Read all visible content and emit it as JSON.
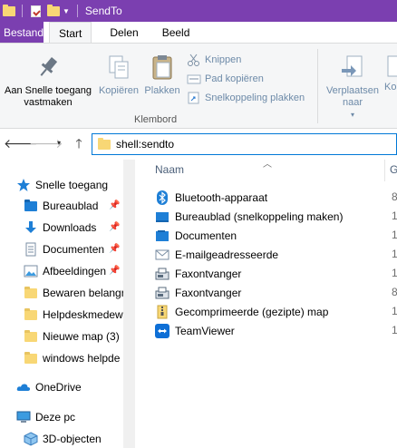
{
  "window": {
    "title": "SendTo"
  },
  "ribbon_tabs": {
    "file": "Bestand",
    "start": "Start",
    "share": "Delen",
    "view": "Beeld"
  },
  "ribbon": {
    "pin_quick_access": "Aan Snelle toegang vastmaken",
    "copy": "Kopiëren",
    "paste": "Plakken",
    "cut": "Knippen",
    "copy_path": "Pad kopiëren",
    "paste_shortcut": "Snelkoppeling plakken",
    "move_to": "Verplaatsen naar",
    "copy_to_partial": "Ko",
    "group_clipboard": "Klembord"
  },
  "address": {
    "path": "shell:sendto"
  },
  "nav_pane": {
    "quick_access": "Snelle toegang",
    "items": [
      {
        "label": "Bureaublad",
        "pinned": true
      },
      {
        "label": "Downloads",
        "pinned": true
      },
      {
        "label": "Documenten",
        "pinned": true
      },
      {
        "label": "Afbeeldingen",
        "pinned": true
      },
      {
        "label": "Bewaren belangr",
        "pinned": false
      },
      {
        "label": "Helpdeskmedew",
        "pinned": false
      },
      {
        "label": "Nieuwe map (3)",
        "pinned": false
      },
      {
        "label": "windows helpde",
        "pinned": false
      }
    ],
    "onedrive": "OneDrive",
    "this_pc": "Deze pc",
    "objects_3d": "3D-objecten"
  },
  "content": {
    "column_name": "Naam",
    "column_next": "G",
    "files": [
      {
        "name": "Bluetooth-apparaat",
        "icon": "bluetooth-icon",
        "next": "8"
      },
      {
        "name": "Bureaublad (snelkoppeling maken)",
        "icon": "desktop-icon",
        "next": "1"
      },
      {
        "name": "Documenten",
        "icon": "documents-icon",
        "next": "1"
      },
      {
        "name": "E-mailgeadresseerde",
        "icon": "mail-icon",
        "next": "1"
      },
      {
        "name": "Faxontvanger",
        "icon": "fax-icon",
        "next": "1"
      },
      {
        "name": "Faxontvanger",
        "icon": "fax-icon",
        "next": "8"
      },
      {
        "name": "Gecomprimeerde (gezipte) map",
        "icon": "zip-folder-icon",
        "next": "1"
      },
      {
        "name": "TeamViewer",
        "icon": "teamviewer-icon",
        "next": "1"
      }
    ]
  },
  "colors": {
    "titlebar": "#7b3fb0",
    "accent": "#0078d7",
    "folder": "#f8d775"
  }
}
